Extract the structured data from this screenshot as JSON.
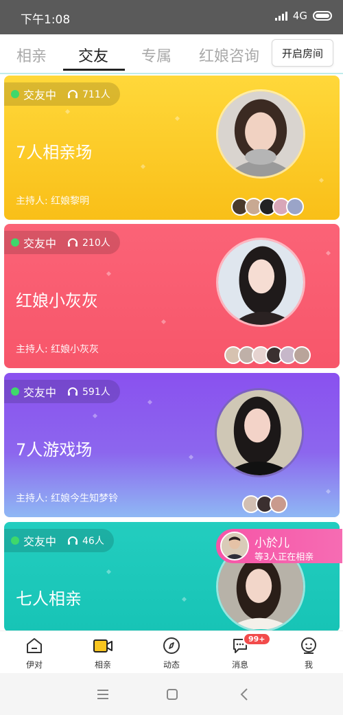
{
  "status_bar": {
    "time": "下午1:08",
    "network": "4G"
  },
  "top_tabs": {
    "items": [
      {
        "label": "相亲",
        "active": false
      },
      {
        "label": "交友",
        "active": true
      },
      {
        "label": "专属",
        "active": false
      },
      {
        "label": "红娘咨询",
        "active": false
      }
    ],
    "open_room_label": "开启房间"
  },
  "rooms": [
    {
      "status": "交友中",
      "listeners": "711人",
      "title": "7人相亲场",
      "host": "主持人: 红娘黎明",
      "color": "#fbc923"
    },
    {
      "status": "交友中",
      "listeners": "210人",
      "title": "红娘小灰灰",
      "host": "主持人: 红娘小灰灰",
      "color": "#f85c70"
    },
    {
      "status": "交友中",
      "listeners": "591人",
      "title": "7人游戏场",
      "host": "主持人: 红娘今生知梦铃",
      "color": "#8a55ef"
    },
    {
      "status": "交友中",
      "listeners": "46人",
      "title": "七人相亲",
      "host": "",
      "color": "#1fc9bb"
    }
  ],
  "toast": {
    "name": "小於儿",
    "subtitle": "等3人正在相亲"
  },
  "bottom_nav": {
    "items": [
      {
        "label": "伊对",
        "icon": "home-icon"
      },
      {
        "label": "相亲",
        "icon": "video-camera-icon",
        "active": true
      },
      {
        "label": "动态",
        "icon": "compass-icon"
      },
      {
        "label": "消息",
        "icon": "chat-bubble-icon",
        "badge": "99+"
      },
      {
        "label": "我",
        "icon": "smiley-profile-icon"
      }
    ]
  },
  "system_nav": {
    "icons": [
      "menu-icon",
      "home-square-icon",
      "back-icon"
    ]
  },
  "colors": {
    "live_dot": "#3fd86b",
    "badge": "#f24b4b",
    "toast": "#f655a7",
    "tab_indicator": "#bfeceb"
  }
}
